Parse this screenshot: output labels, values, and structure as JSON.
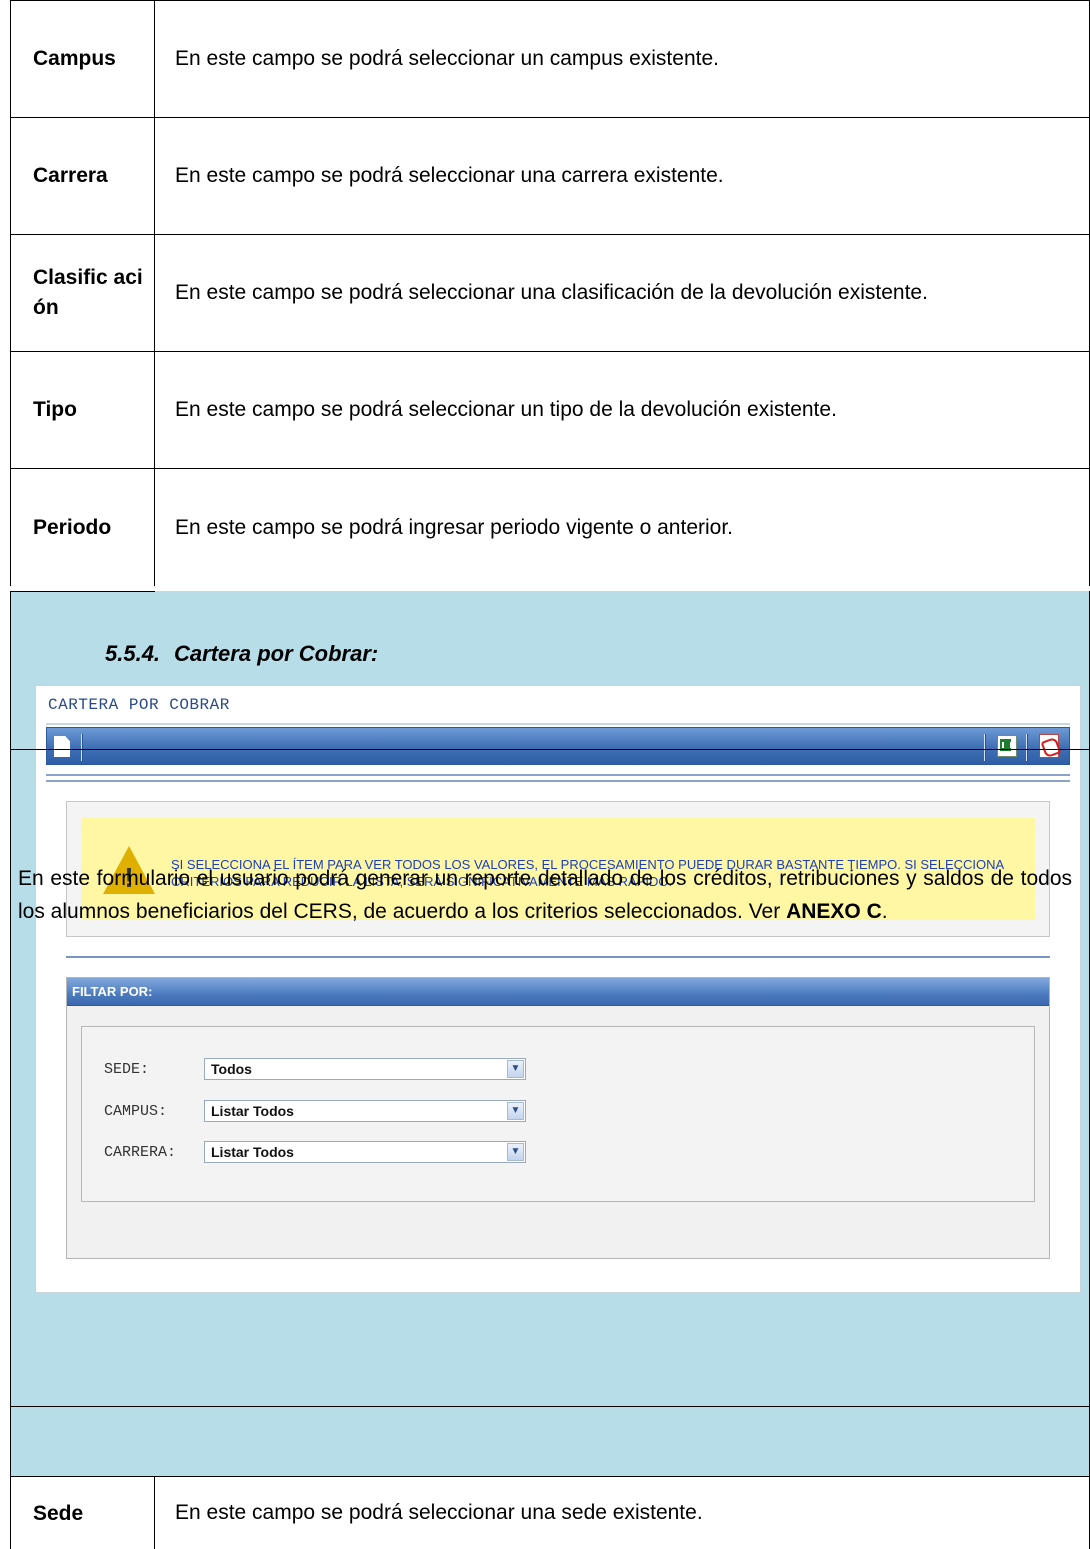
{
  "definitions": [
    {
      "term": "Campus",
      "desc": "En este campo se podrá seleccionar un campus existente."
    },
    {
      "term": "Carrera",
      "desc": "En este campo se podrá seleccionar una carrera existente."
    },
    {
      "term": "Clasific ación",
      "desc": "En este campo se podrá seleccionar una clasificación de la devolución existente."
    },
    {
      "term": "Tipo",
      "desc": "En este campo se podrá seleccionar un tipo de la devolución existente."
    },
    {
      "term": "Periodo",
      "desc": "En este campo se podrá ingresar periodo vigente o anterior."
    }
  ],
  "section": {
    "number": "5.5.4.",
    "title": "Cartera por Cobrar:"
  },
  "screenshot": {
    "title": "CARTERA POR COBRAR",
    "toolbar_icons": [
      "new-document-icon",
      "excel-export-icon",
      "pdf-export-icon"
    ],
    "warning_text": "SI SELECCIONA EL ÍTEM PARA VER TODOS LOS VALORES, EL PROCESAMIENTO PUEDE DURAR BASTANTE TIEMPO. SI SELECCIONA CRITERIOS PARA REDUCIR LA LISTA, SERÁ SIGNIFICATIVAMENTE MÁS RÁPIDO.",
    "filter_title": "FILTAR POR:",
    "filters": [
      {
        "label": "SEDE:",
        "value": "Todos"
      },
      {
        "label": "CAMPUS:",
        "value": "Listar Todos"
      },
      {
        "label": "CARRERA:",
        "value": "Listar Todos"
      }
    ]
  },
  "paragraph": {
    "text": "En este formulario el usuario podrá generar un reporte detallado de los créditos, retribuciones y saldos de todos los alumnos beneficiarios del CERS, de acuerdo a los criterios seleccionados. Ver ",
    "bold": "ANEXO C",
    "tail": "."
  },
  "bottom_definition": {
    "term": "Sede",
    "desc": "En este campo se podrá seleccionar una sede existente."
  },
  "colors": {
    "section_background": "#b7dde8",
    "toolbar": "#3f6fb4",
    "warning_background": "#fff7a3",
    "warning_text": "#1b3fbf"
  }
}
